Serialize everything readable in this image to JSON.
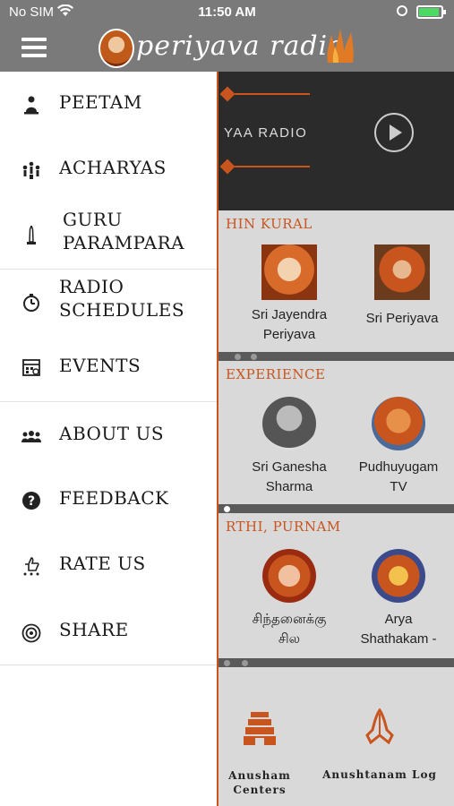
{
  "status_bar": {
    "carrier": "No SIM",
    "time": "11:50 AM"
  },
  "header": {
    "logo_text": "periyava radio"
  },
  "player": {
    "title": "YAA RADIO"
  },
  "sections": [
    {
      "title": "HIN KURAL",
      "items": [
        {
          "label": "Sri Jayendra Periyava"
        },
        {
          "label": "Sri Periyava"
        }
      ]
    },
    {
      "title": " EXPERIENCE",
      "items": [
        {
          "label": "Sri Ganesha Sharma"
        },
        {
          "label": "Pudhuyugam TV"
        }
      ]
    },
    {
      "title": "RTHI, PURNAM",
      "items": [
        {
          "label": "சிந்தனைக்கு சில"
        },
        {
          "label": "Arya Shathakam -"
        }
      ]
    }
  ],
  "bottom": {
    "items": [
      {
        "label": "Anusham Centers"
      },
      {
        "label": "Anushtanam Log"
      }
    ]
  },
  "menu": [
    {
      "label": "PEETAM",
      "icon": "peetam-icon"
    },
    {
      "label": "ACHARYAS",
      "icon": "acharyas-icon"
    },
    {
      "label": "GURU PARAMPARA",
      "icon": "tower-icon"
    },
    {
      "label": "RADIO SCHEDULES",
      "icon": "stopwatch-icon"
    },
    {
      "label": "EVENTS",
      "icon": "calendar-icon"
    },
    {
      "label": "ABOUT US",
      "icon": "group-icon"
    },
    {
      "label": "FEEDBACK",
      "icon": "question-icon"
    },
    {
      "label": "RATE US",
      "icon": "thumbs-up-icon"
    },
    {
      "label": "SHARE",
      "icon": "share-icon"
    }
  ],
  "colors": {
    "accent": "#c8541e",
    "header": "#7a7a7a",
    "player": "#2b2b2b"
  }
}
